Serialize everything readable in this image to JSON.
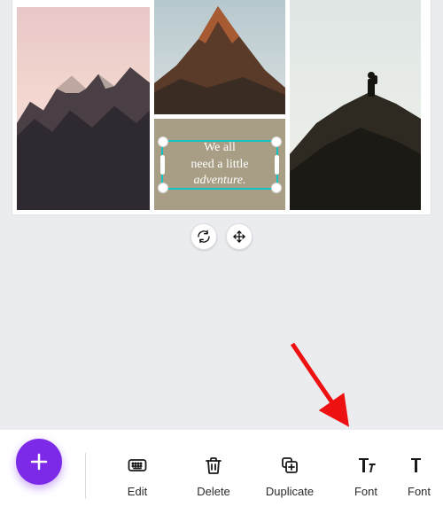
{
  "canvas": {
    "text_element": {
      "line1": "We all",
      "line2": "need a little",
      "line3": "adventure."
    },
    "selection_color": "#14c4c4",
    "text_bg_color": "#a79e85"
  },
  "float_controls": {
    "rotate_icon": "rotate",
    "move_icon": "move"
  },
  "fab": {
    "icon": "plus"
  },
  "toolbar": {
    "items": [
      {
        "icon": "keyboard",
        "label": "Edit"
      },
      {
        "icon": "trash",
        "label": "Delete"
      },
      {
        "icon": "duplicate",
        "label": "Duplicate"
      },
      {
        "icon": "font",
        "label": "Font"
      },
      {
        "icon": "font",
        "label": "Font"
      }
    ]
  },
  "arrow_color": "#e11",
  "accent_color": "#7d2ae8",
  "icon_color": "#1a1a1a"
}
